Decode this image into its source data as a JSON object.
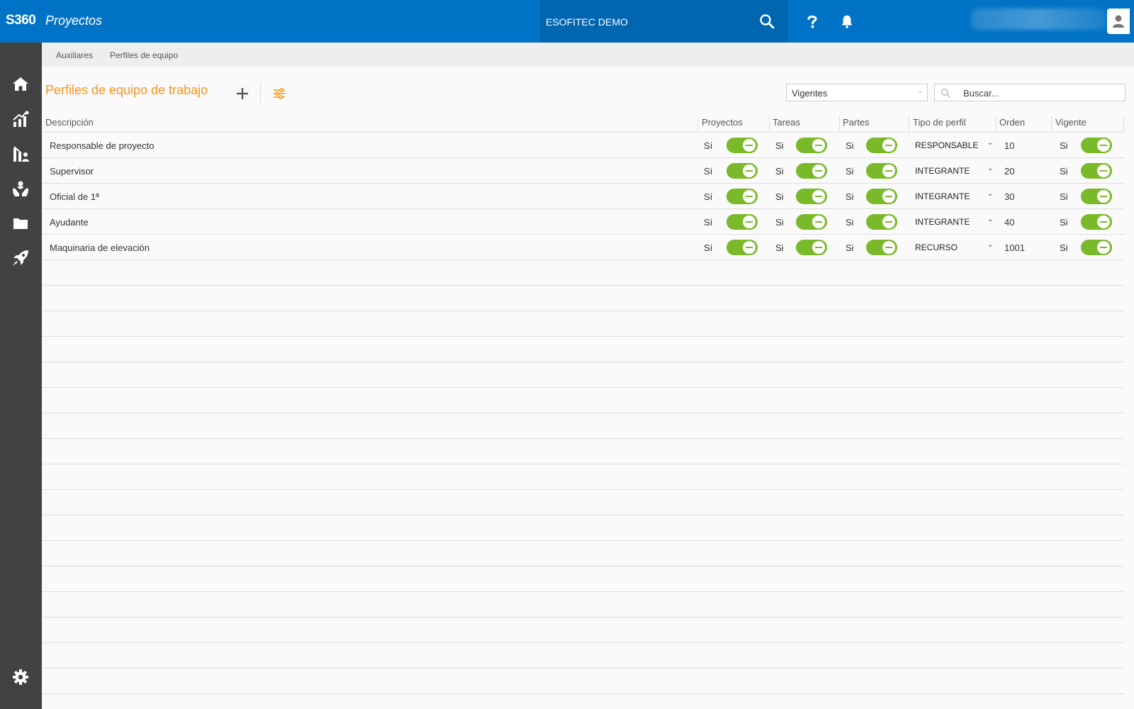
{
  "header": {
    "brand": "S360",
    "app_title": "Proyectos",
    "company": "ESOFITEC DEMO",
    "icons": [
      "search-icon",
      "help-icon",
      "bell-icon",
      "user-icon"
    ]
  },
  "sidebar": {
    "items": [
      {
        "icon": "home-icon"
      },
      {
        "icon": "analytics-icon"
      },
      {
        "icon": "reports-icon"
      },
      {
        "icon": "resources-icon"
      },
      {
        "icon": "folder-icon"
      },
      {
        "icon": "rocket-icon"
      }
    ],
    "settings_icon": "gear-icon"
  },
  "breadcrumb": [
    "Auxiliares",
    "Perfiles de equipo"
  ],
  "page": {
    "title": "Perfiles de equipo de trabajo",
    "status_filter": "Vigentes",
    "search_placeholder": "Buscar..."
  },
  "table": {
    "columns": [
      "Descripción",
      "Proyectos",
      "Tareas",
      "Partes",
      "Tipo de perfil",
      "Orden",
      "Vigente"
    ],
    "rows": [
      {
        "descripcion": "Responsable de proyecto",
        "proyectos": "Sí",
        "tareas": "Si",
        "partes": "Si",
        "tipo": "RESPONSABLE",
        "orden": "10",
        "vigente": "Si"
      },
      {
        "descripcion": "Supervisor",
        "proyectos": "Sí",
        "tareas": "Si",
        "partes": "Si",
        "tipo": "INTEGRANTE",
        "orden": "20",
        "vigente": "Si"
      },
      {
        "descripcion": "Oficial de 1ª",
        "proyectos": "Sí",
        "tareas": "Si",
        "partes": "Si",
        "tipo": "INTEGRANTE",
        "orden": "30",
        "vigente": "Si"
      },
      {
        "descripcion": "Ayudante",
        "proyectos": "Sí",
        "tareas": "Si",
        "partes": "Si",
        "tipo": "INTEGRANTE",
        "orden": "40",
        "vigente": "Si"
      },
      {
        "descripcion": "Maquinaria de elevación",
        "proyectos": "Sí",
        "tareas": "Si",
        "partes": "Si",
        "tipo": "RECURSO",
        "orden": "1001",
        "vigente": "Si"
      }
    ]
  },
  "colors": {
    "topbar": "#0073c6",
    "sidebar": "#424242",
    "accent": "#f7941d",
    "toggle_on": "#7ab929"
  }
}
